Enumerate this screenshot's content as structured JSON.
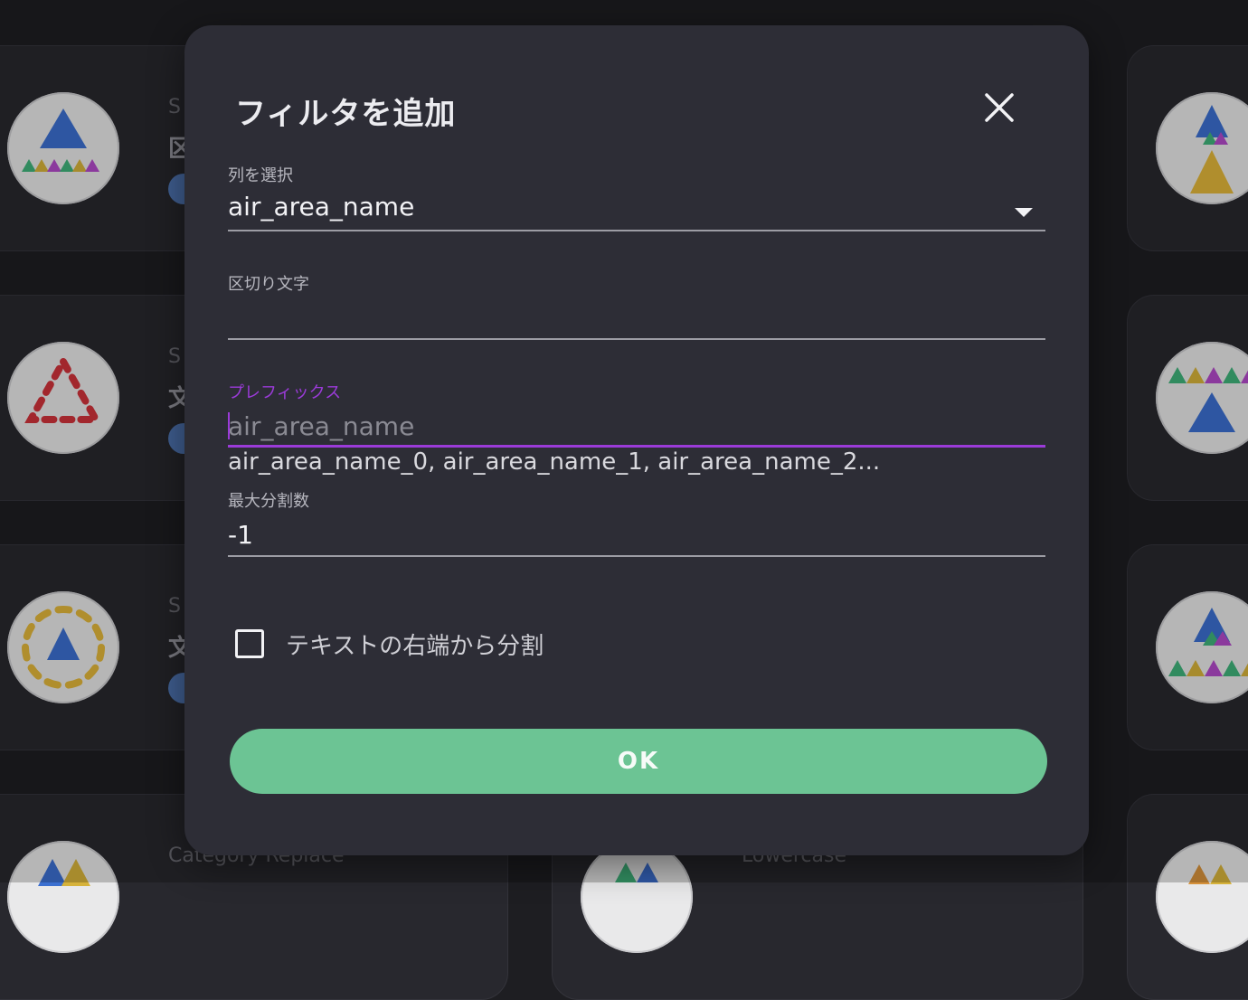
{
  "dialog": {
    "title": "フィルタを追加",
    "close_icon": "close-icon"
  },
  "fields": {
    "column": {
      "label": "列を選択",
      "value": "air_area_name"
    },
    "separator": {
      "label": "区切り文字",
      "value": ""
    },
    "prefix": {
      "label": "プレフィックス",
      "placeholder": "air_area_name",
      "helper": "air_area_name_0, air_area_name_1, air_area_name_2..."
    },
    "max_split": {
      "label": "最大分割数",
      "value": "-1"
    }
  },
  "checkbox": {
    "label": "テキストの右端から分割",
    "checked": false
  },
  "ok_button": {
    "label": "OK"
  },
  "background": {
    "card_titles_partial": [
      "S",
      "区",
      "S",
      "文",
      "S",
      "文"
    ],
    "bottom_titles": [
      "Category Replace",
      "Lowercase"
    ]
  },
  "colors": {
    "accent": "#9b3bd9",
    "ok_button": "#6cc494",
    "dialog_bg": "#2d2d36"
  }
}
